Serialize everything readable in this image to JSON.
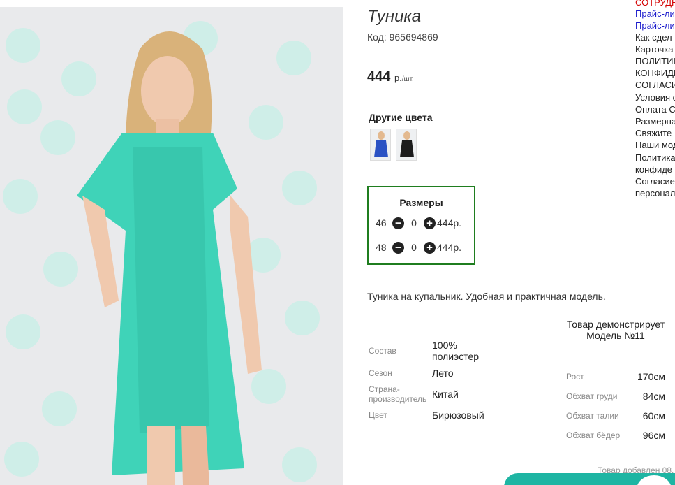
{
  "product": {
    "title": "Туника",
    "code": "Код: 965694869",
    "price_value": "444",
    "price_unit": "р.",
    "price_per": "/шт.",
    "other_colors_title": "Другие цвета",
    "other_colors": [
      {
        "name": "blue",
        "color": "#2a52c4"
      },
      {
        "name": "black",
        "color": "#1c1c1c"
      }
    ],
    "description": "Туника на купальник. Удобная и практичная модель."
  },
  "sizes": {
    "title": "Размеры",
    "rows": [
      {
        "size": "46",
        "qty": "0",
        "price": "444р."
      },
      {
        "size": "48",
        "qty": "0",
        "price": "444р."
      }
    ],
    "minus_icon": "minus-circle-icon",
    "plus_icon": "plus-circle-icon",
    "border_color": "#1f7d1f"
  },
  "properties": [
    {
      "label": "Состав",
      "value": "100% полиэстер"
    },
    {
      "label": "Сезон",
      "value": "Лето"
    },
    {
      "label": "Страна-производитель",
      "value": "Китай"
    },
    {
      "label": "Цвет",
      "value": "Бирюзовый"
    }
  ],
  "model": {
    "heading": "Товар демонстрирует Модель №11",
    "measurements": [
      {
        "label": "Рост",
        "value": "170см"
      },
      {
        "label": "Обхват груди",
        "value": "84см"
      },
      {
        "label": "Обхват талии",
        "value": "60см"
      },
      {
        "label": "Обхват бёдер",
        "value": "96см"
      }
    ]
  },
  "added_text": "Товар добавлен 08.",
  "side_links": [
    {
      "text": "СОТРУДН",
      "style": "red"
    },
    {
      "text": "Прайс-ли",
      "style": "blue"
    },
    {
      "text": "Прайс-ли",
      "style": "blue"
    },
    {
      "text": "Как сдел",
      "style": "plain"
    },
    {
      "text": "Карточка",
      "style": "plain"
    },
    {
      "text": "ПОЛИТИК",
      "style": "plain"
    },
    {
      "text": "КОНФИДЕ",
      "style": "plain"
    },
    {
      "text": "СОГЛАСИ",
      "style": "plain"
    },
    {
      "text": "Условия с",
      "style": "plain"
    },
    {
      "text": "Оплата С",
      "style": "plain"
    },
    {
      "text": "Размерна",
      "style": "plain"
    },
    {
      "text": "Свяжите",
      "style": "plain"
    },
    {
      "text": "Наши мод",
      "style": "plain"
    },
    {
      "text": "Политика",
      "style": "plain"
    },
    {
      "text": "конфиде",
      "style": "plain"
    },
    {
      "text": "Согласие",
      "style": "plain"
    },
    {
      "text": "персонал",
      "style": "plain"
    }
  ],
  "colors": {
    "accent_teal": "#1eb5a3",
    "dress_turquoise": "#3fd3b8",
    "link_blue": "#1a1acc",
    "link_red": "#d40000"
  }
}
